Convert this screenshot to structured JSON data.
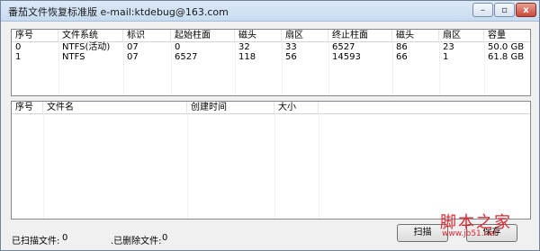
{
  "window": {
    "title": "番茄文件恢复标准版 e-mail:ktdebug@163.com",
    "min_symbol": "–",
    "max_symbol": "▫",
    "close_symbol": "x"
  },
  "partitions": {
    "columns": [
      "序号",
      "文件系统",
      "标识",
      "起始柱面",
      "磁头",
      "扇区",
      "终止柱面",
      "磁头",
      "扇区",
      "容量"
    ],
    "rows": [
      [
        "0",
        "NTFS(活动)",
        "07",
        "0",
        "32",
        "33",
        "6527",
        "86",
        "23",
        "50.0 GB"
      ],
      [
        "1",
        "NTFS",
        "07",
        "6527",
        "118",
        "56",
        "14593",
        "66",
        "1",
        "61.8 GB"
      ]
    ]
  },
  "files": {
    "columns": [
      "序号",
      "文件名",
      "创建时间",
      "大小"
    ],
    "rows": []
  },
  "status": {
    "scanned_label": "已扫描文件:",
    "scanned_value": "0",
    "deleted_label": ".已删除文件:",
    "deleted_value": "0"
  },
  "buttons": {
    "scan": "扫描",
    "save": "保存"
  },
  "watermark": {
    "text": "脚本之家",
    "url": "www.jb51.net"
  }
}
